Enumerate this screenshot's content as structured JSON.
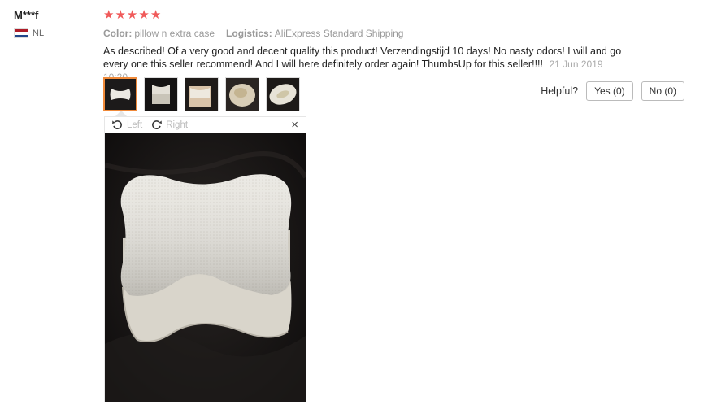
{
  "reviewer": {
    "name": "M***f",
    "country": "NL"
  },
  "rating": {
    "stars": 5,
    "max": 5,
    "star_color": "#f05a5a"
  },
  "properties": {
    "color_label": "Color:",
    "color_value": "pillow n extra case",
    "logistics_label": "Logistics:",
    "logistics_value": "AliExpress Standard Shipping"
  },
  "review": {
    "text": "As described! Of a very good and decent quality this product! Verzendingstijd 10 days! No nasty odors! I will and go every one this seller recommend! And I will here definitely order again! ThumbsUp for this seller!!!!",
    "date": "21 Jun 2019 10:20"
  },
  "helpful": {
    "label": "Helpful?",
    "yes_label": "Yes (0)",
    "no_label": "No (0)"
  },
  "viewer": {
    "rotate_left": "Left",
    "rotate_right": "Right",
    "close_glyph": "×"
  },
  "icons": {
    "flag": "netherlands-flag-icon",
    "star": "star-icon",
    "rotate_left": "rotate-left-icon",
    "rotate_right": "rotate-right-icon",
    "close": "close-icon"
  },
  "colors": {
    "accent": "#f08a3a",
    "muted": "#999999"
  }
}
